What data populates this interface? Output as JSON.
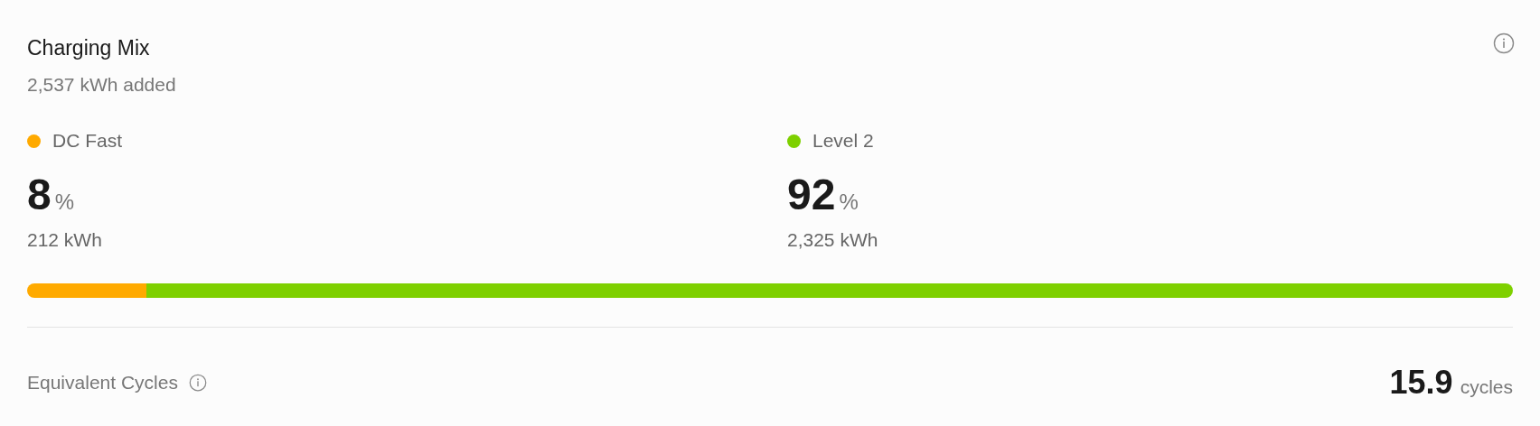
{
  "title": "Charging Mix",
  "subtitle": "2,537 kWh added",
  "segments": [
    {
      "label": "DC Fast",
      "color": "#ffaa00",
      "percent": "8",
      "unit": "%",
      "energy": "212 kWh"
    },
    {
      "label": "Level 2",
      "color": "#7ed000",
      "percent": "92",
      "unit": "%",
      "energy": "2,325 kWh"
    }
  ],
  "footer": {
    "label": "Equivalent Cycles",
    "value": "15.9",
    "unit": "cycles"
  }
}
